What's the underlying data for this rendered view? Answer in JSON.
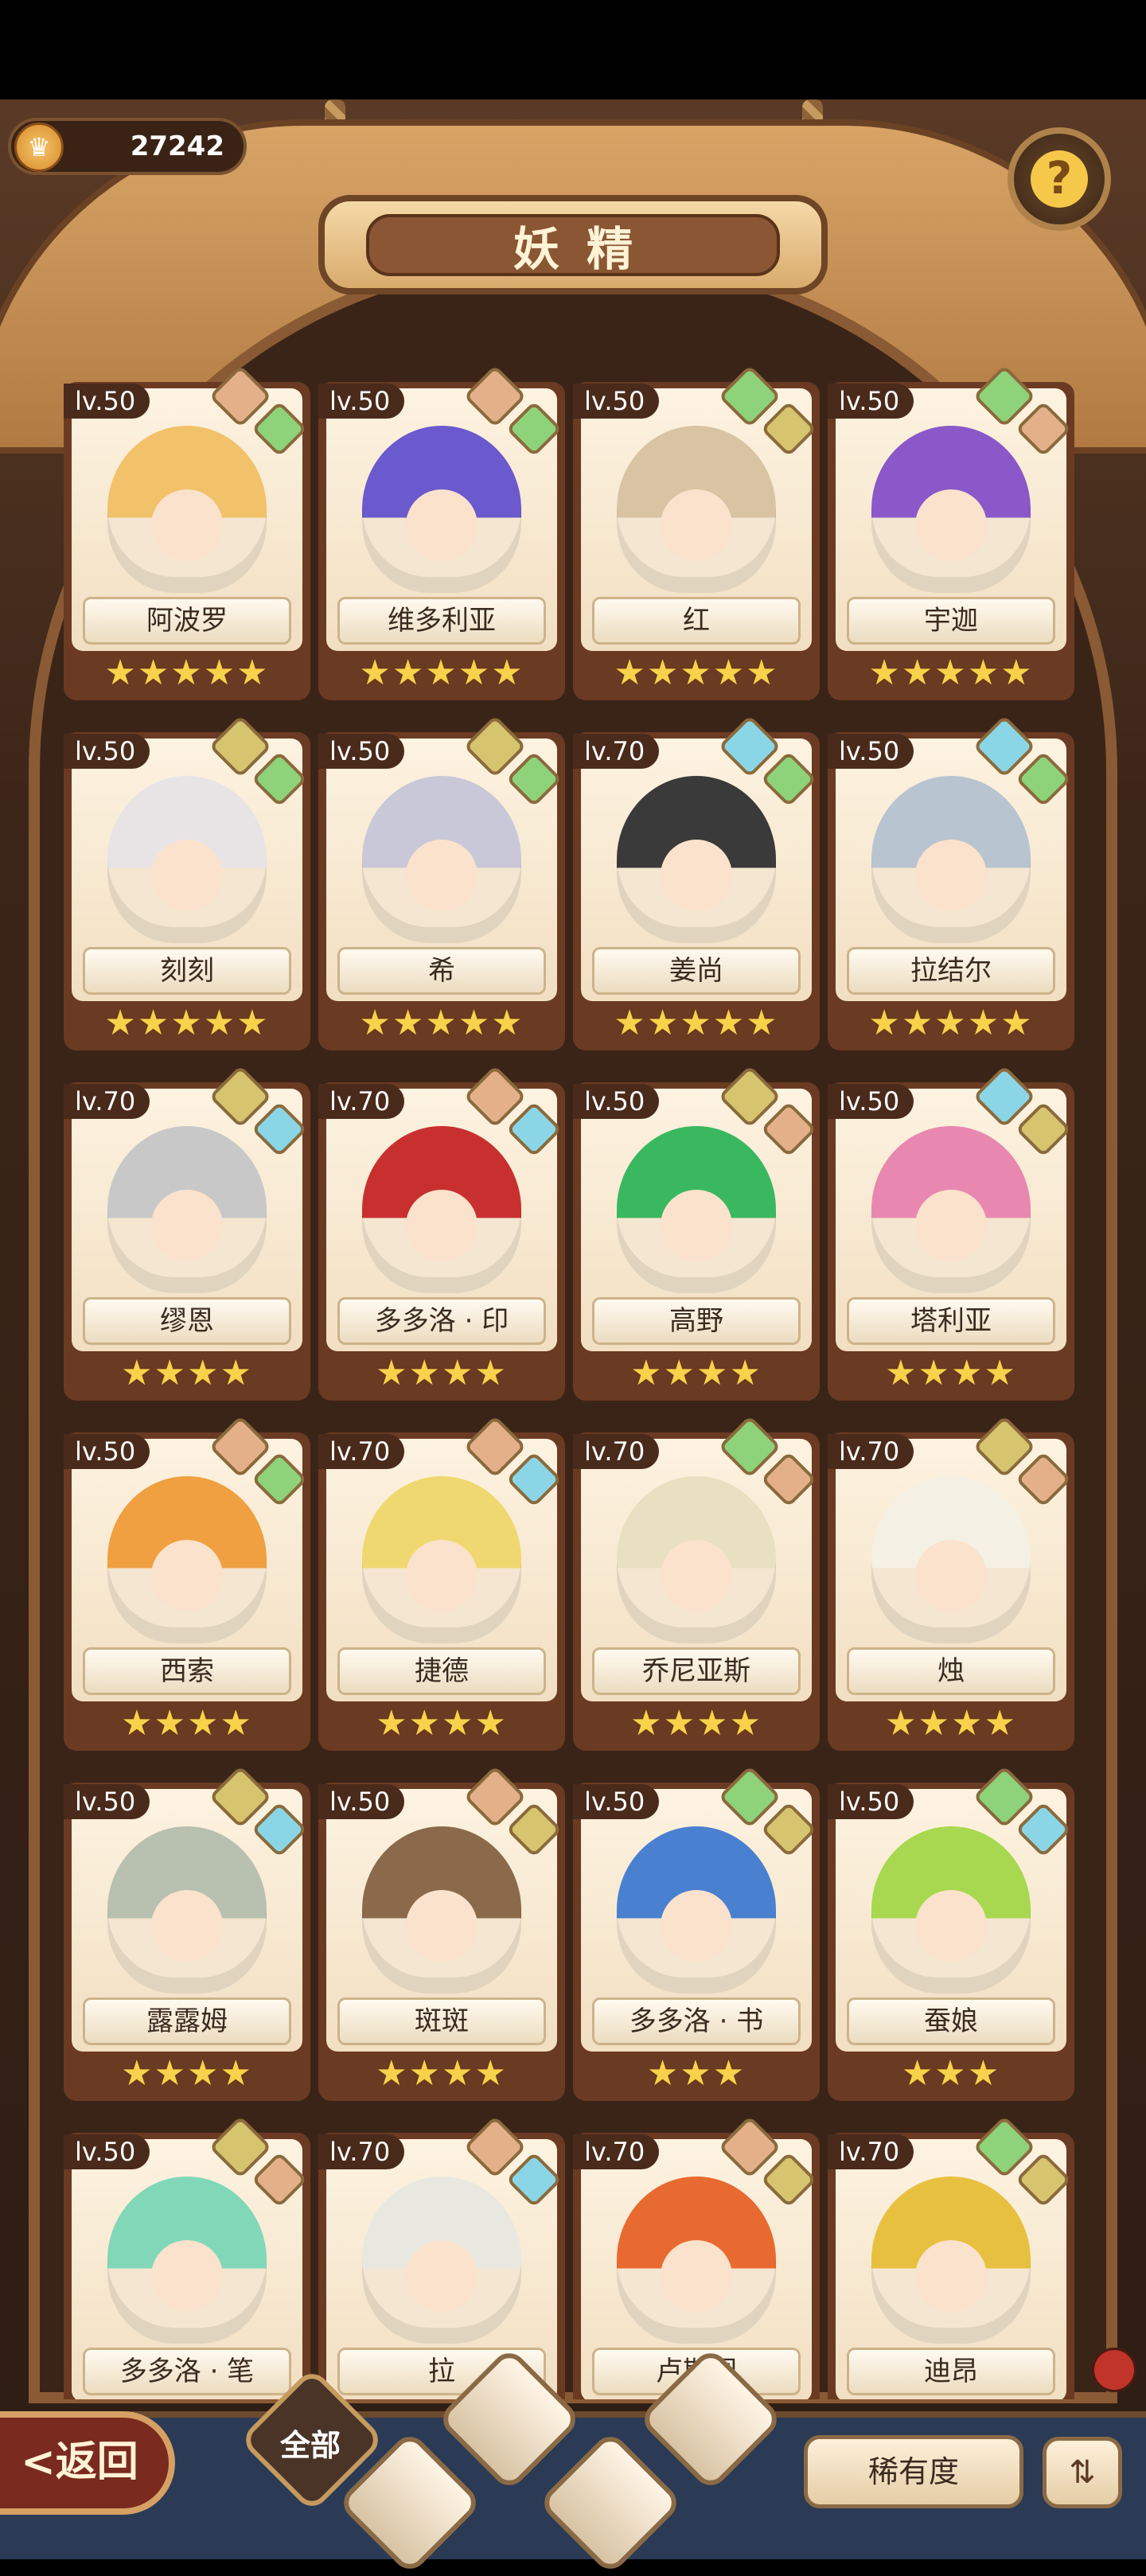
{
  "header": {
    "title": "妖精",
    "currency": "27242",
    "help_icon": "question-mark-icon"
  },
  "fairies": [
    {
      "level": "lv.50",
      "name": "阿波罗",
      "stars": "★★★★★",
      "badges": [
        "earth-fire",
        "leaf"
      ],
      "color": "#f2c26a"
    },
    {
      "level": "lv.50",
      "name": "维多利亚",
      "stars": "★★★★★",
      "badges": [
        "earth-fire",
        "leaf"
      ],
      "color": "#6a5acd"
    },
    {
      "level": "lv.50",
      "name": "红",
      "stars": "★★★★★",
      "badges": [
        "leaf",
        "earth"
      ],
      "color": "#d8c3a3"
    },
    {
      "level": "lv.50",
      "name": "宇迦",
      "stars": "★★★★★",
      "badges": [
        "leaf",
        "earth-fire"
      ],
      "color": "#8a58c8"
    },
    {
      "level": "lv.50",
      "name": "刻刻",
      "stars": "★★★★★",
      "badges": [
        "earth",
        "leaf"
      ],
      "color": "#e8e4e6"
    },
    {
      "level": "lv.50",
      "name": "希",
      "stars": "★★★★★",
      "badges": [
        "earth",
        "leaf"
      ],
      "color": "#c8c8d8"
    },
    {
      "level": "lv.70",
      "name": "姜尚",
      "stars": "★★★★★",
      "badges": [
        "water",
        "leaf"
      ],
      "color": "#3a3a3a"
    },
    {
      "level": "lv.50",
      "name": "拉结尔",
      "stars": "★★★★★",
      "badges": [
        "water",
        "leaf"
      ],
      "color": "#b8c4d0"
    },
    {
      "level": "lv.70",
      "name": "缪恩",
      "stars": "★★★★",
      "badges": [
        "earth",
        "water"
      ],
      "color": "#c8c8c8"
    },
    {
      "level": "lv.70",
      "name": "多多洛 · 印",
      "stars": "★★★★",
      "badges": [
        "earth-fire",
        "water"
      ],
      "color": "#c83030"
    },
    {
      "level": "lv.50",
      "name": "高野",
      "stars": "★★★★",
      "badges": [
        "earth",
        "earth-fire"
      ],
      "color": "#3ab860"
    },
    {
      "level": "lv.50",
      "name": "塔利亚",
      "stars": "★★★★",
      "badges": [
        "water",
        "earth"
      ],
      "color": "#e888b0"
    },
    {
      "level": "lv.50",
      "name": "西索",
      "stars": "★★★★",
      "badges": [
        "earth-fire",
        "leaf"
      ],
      "color": "#f0a040"
    },
    {
      "level": "lv.70",
      "name": "捷德",
      "stars": "★★★★",
      "badges": [
        "earth-fire",
        "water"
      ],
      "color": "#f0d870"
    },
    {
      "level": "lv.70",
      "name": "乔尼亚斯",
      "stars": "★★★★",
      "badges": [
        "leaf",
        "earth-fire"
      ],
      "color": "#e8e0c0"
    },
    {
      "level": "lv.70",
      "name": "烛",
      "stars": "★★★★",
      "badges": [
        "earth",
        "earth-fire"
      ],
      "color": "#f4f0e4"
    },
    {
      "level": "lv.50",
      "name": "露露姆",
      "stars": "★★★★",
      "badges": [
        "earth",
        "water"
      ],
      "color": "#b8c0b0"
    },
    {
      "level": "lv.50",
      "name": "斑斑",
      "stars": "★★★★",
      "badges": [
        "earth-fire",
        "earth"
      ],
      "color": "#8a6a4a"
    },
    {
      "level": "lv.50",
      "name": "多多洛 · 书",
      "stars": "★★★",
      "badges": [
        "leaf",
        "earth"
      ],
      "color": "#4a80d0"
    },
    {
      "level": "lv.50",
      "name": "蚕娘",
      "stars": "★★★",
      "badges": [
        "leaf",
        "water"
      ],
      "color": "#a8d850"
    },
    {
      "level": "lv.50",
      "name": "多多洛 · 笔",
      "stars": "",
      "badges": [
        "earth",
        "earth-fire"
      ],
      "color": "#80d8b8"
    },
    {
      "level": "lv.70",
      "name": "拉",
      "stars": "",
      "badges": [
        "earth-fire",
        "water"
      ],
      "color": "#e8e8e0"
    },
    {
      "level": "lv.70",
      "name": "卢斯图",
      "stars": "",
      "badges": [
        "earth-fire",
        "earth"
      ],
      "color": "#e86a30"
    },
    {
      "level": "lv.70",
      "name": "迪昂",
      "stars": "",
      "badges": [
        "leaf",
        "earth"
      ],
      "color": "#e8c040"
    }
  ],
  "badge_colors": {
    "earth-fire": "#e4b08a",
    "leaf": "#8ed27a",
    "earth": "#d6c46e",
    "water": "#8ad6e6"
  },
  "footer": {
    "back": "<返回",
    "all": "全部",
    "rarity": "稀有度",
    "sort_icon": "sort-list-icon"
  }
}
